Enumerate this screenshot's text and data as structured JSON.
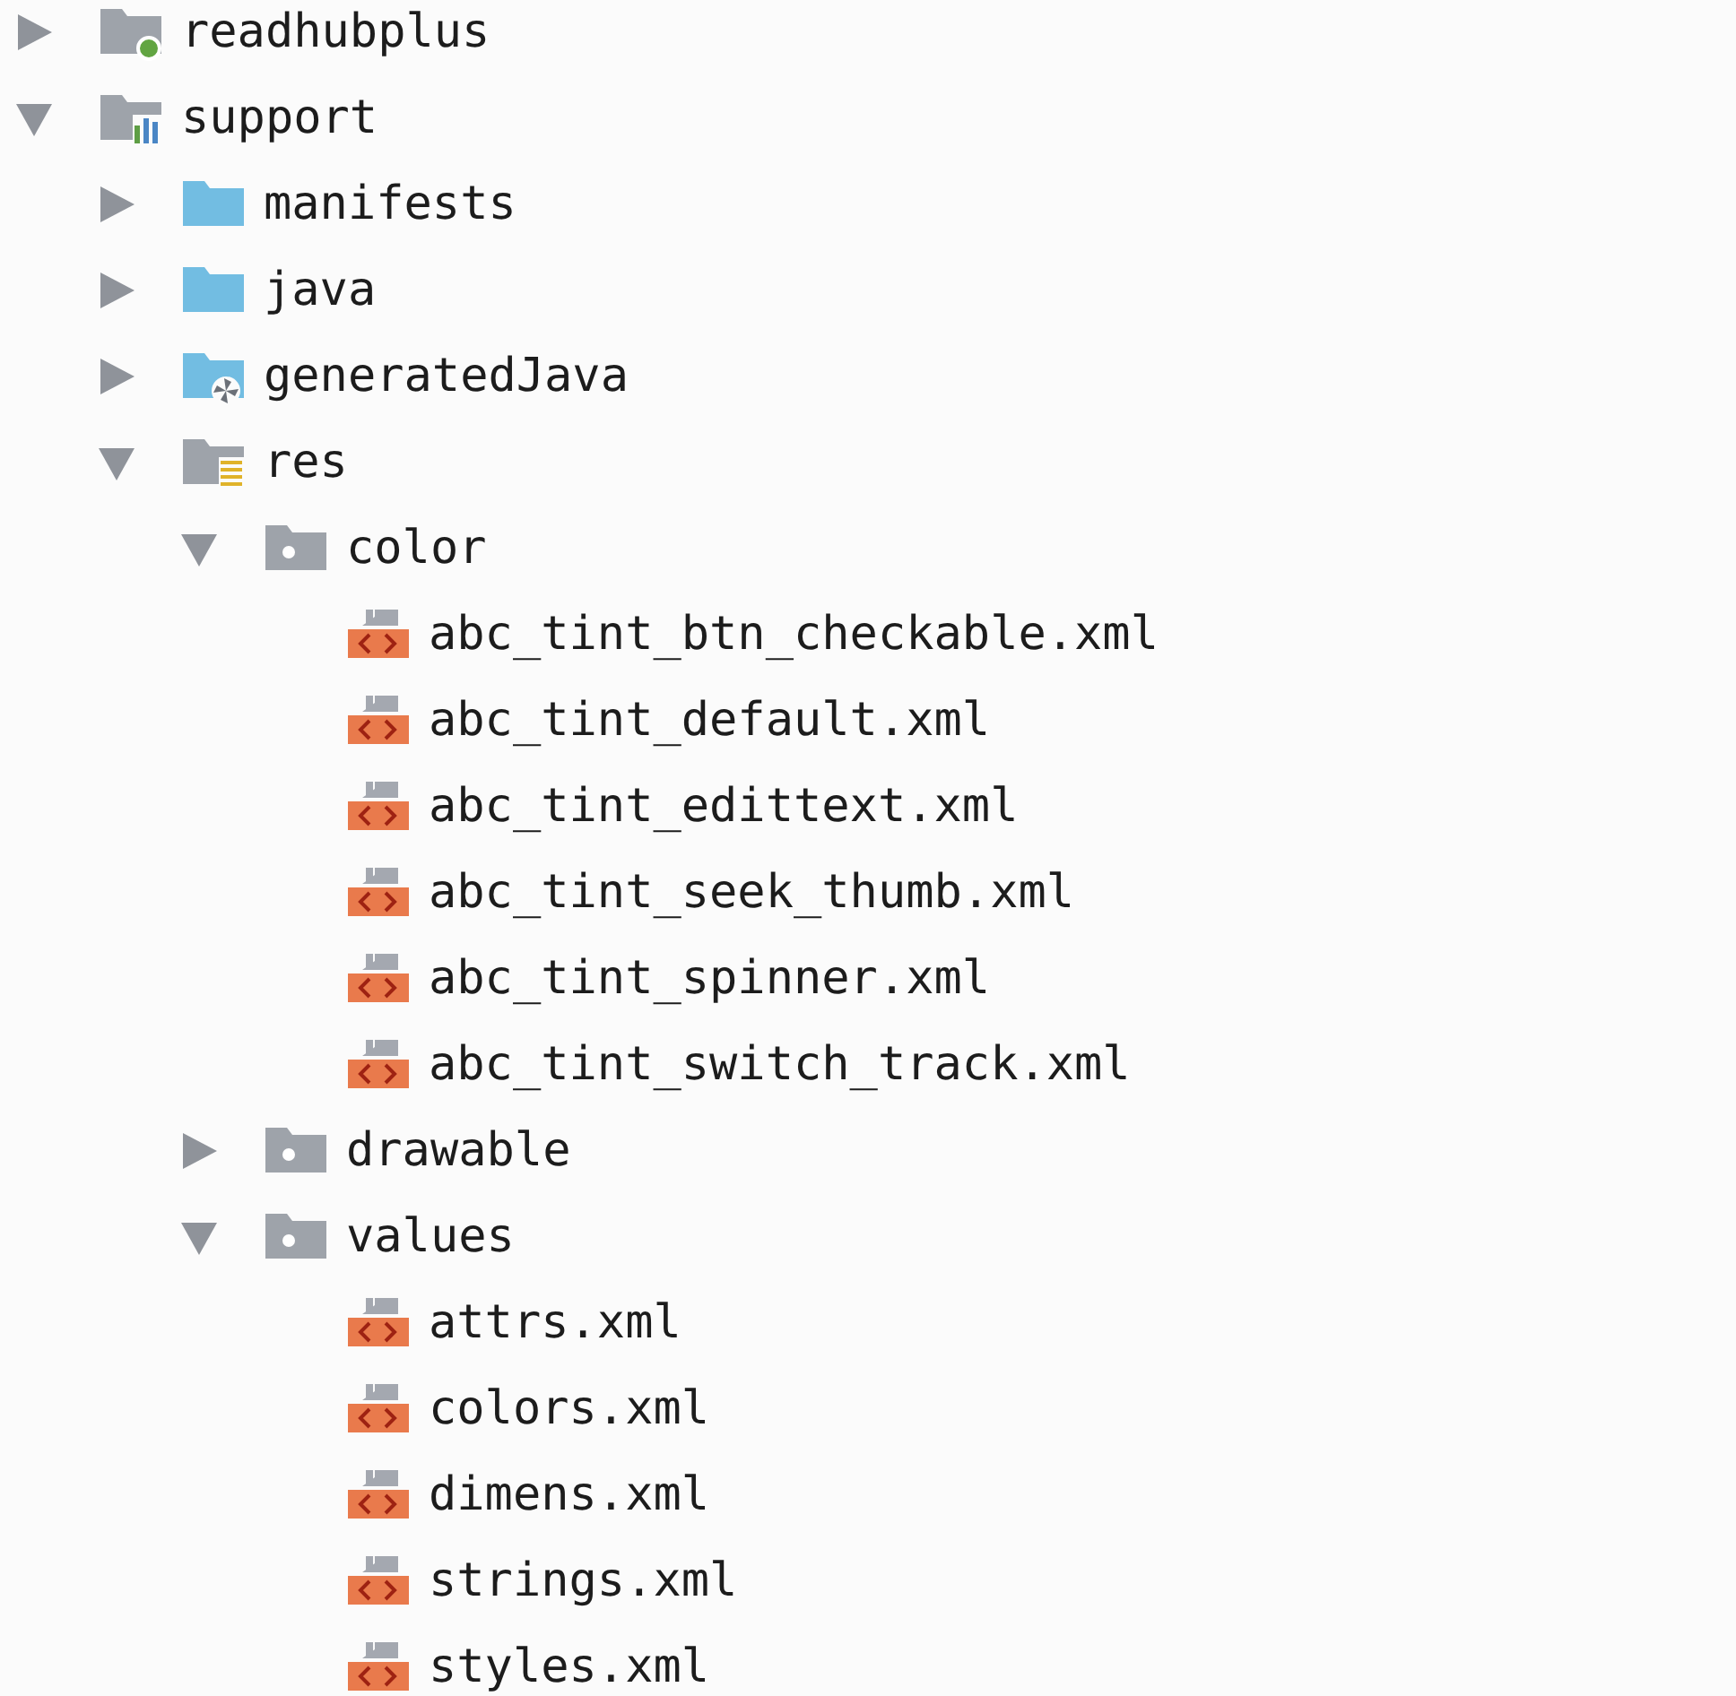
{
  "tree": [
    {
      "label": "readhubplus",
      "kind": "module",
      "expanded": false
    },
    {
      "label": "support",
      "kind": "library",
      "expanded": true,
      "children": [
        {
          "label": "manifests",
          "kind": "folder",
          "expanded": false
        },
        {
          "label": "java",
          "kind": "folder",
          "expanded": false
        },
        {
          "label": "generatedJava",
          "kind": "generated",
          "expanded": false
        },
        {
          "label": "res",
          "kind": "res",
          "expanded": true,
          "children": [
            {
              "label": "color",
              "kind": "resdir",
              "expanded": true,
              "children": [
                {
                  "label": "abc_tint_btn_checkable.xml",
                  "kind": "xml"
                },
                {
                  "label": "abc_tint_default.xml",
                  "kind": "xml"
                },
                {
                  "label": "abc_tint_edittext.xml",
                  "kind": "xml"
                },
                {
                  "label": "abc_tint_seek_thumb.xml",
                  "kind": "xml"
                },
                {
                  "label": "abc_tint_spinner.xml",
                  "kind": "xml"
                },
                {
                  "label": "abc_tint_switch_track.xml",
                  "kind": "xml"
                }
              ]
            },
            {
              "label": "drawable",
              "kind": "resdir",
              "expanded": false
            },
            {
              "label": "values",
              "kind": "resdir",
              "expanded": true,
              "children": [
                {
                  "label": "attrs.xml",
                  "kind": "xml"
                },
                {
                  "label": "colors.xml",
                  "kind": "xml"
                },
                {
                  "label": "dimens.xml",
                  "kind": "xml"
                },
                {
                  "label": "strings.xml",
                  "kind": "xml"
                },
                {
                  "label": "styles.xml",
                  "kind": "xml"
                }
              ]
            }
          ]
        }
      ]
    }
  ]
}
